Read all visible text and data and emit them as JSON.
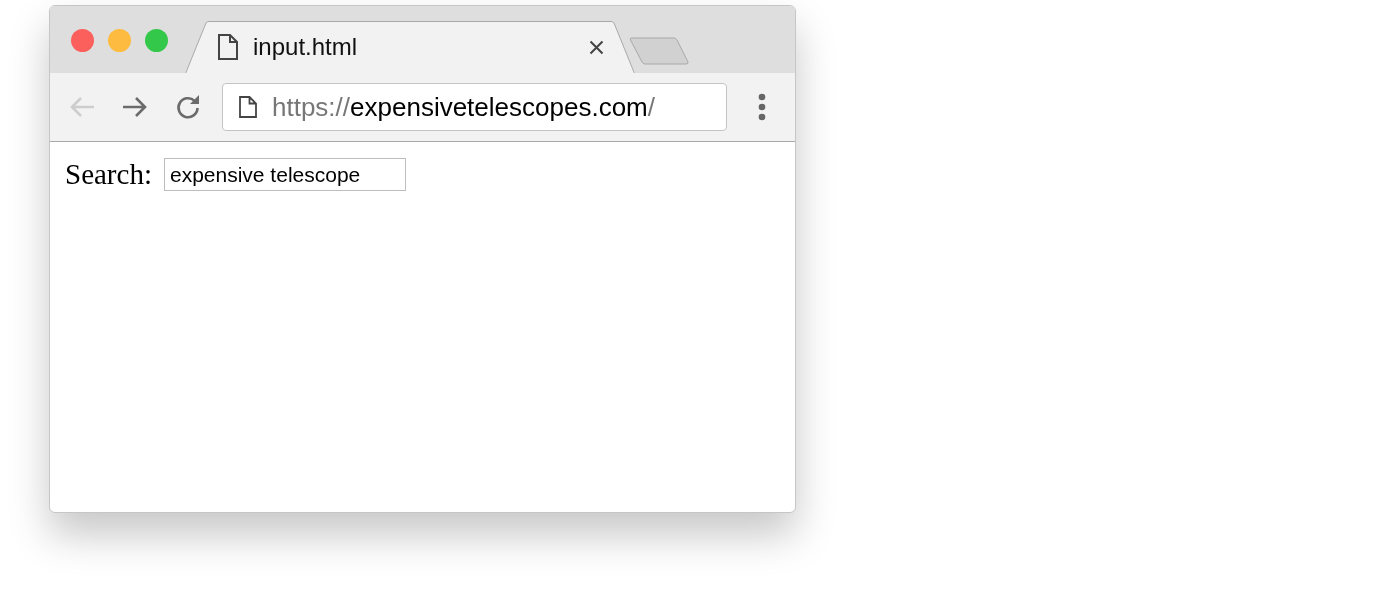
{
  "window": {
    "controls": [
      {
        "kind": "close",
        "color": "#fc605c"
      },
      {
        "kind": "minimize",
        "color": "#fdbc40"
      },
      {
        "kind": "zoom",
        "color": "#34c84a"
      }
    ]
  },
  "tabs": [
    {
      "title": "input.html",
      "selected": true
    }
  ],
  "toolbar": {
    "buttons": [
      {
        "kind": "back",
        "disabled": true
      },
      {
        "kind": "forward",
        "disabled": false
      },
      {
        "kind": "reload",
        "disabled": false
      }
    ],
    "address_bar": {
      "scheme": "https://",
      "host": "expensivetelescopes.com",
      "path": "/"
    }
  },
  "page": {
    "search_label": "Search:",
    "search_field": {
      "value": "expensive telescope"
    }
  }
}
